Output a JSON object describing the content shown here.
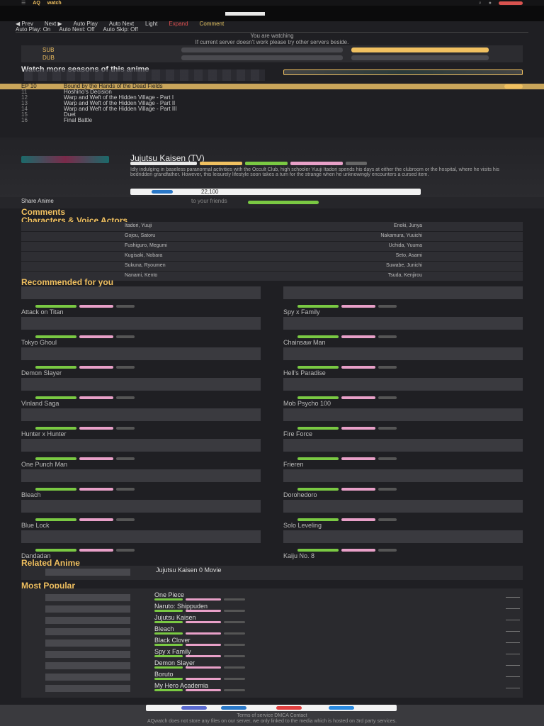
{
  "topbar": {
    "logo_top": "AQ",
    "logo_bottom": "watch"
  },
  "episode_nav": {
    "row1": [
      "◀ Prev",
      "Next ▶",
      "Auto Play",
      "Auto Next",
      "Light",
      "Expand",
      "Comment"
    ],
    "row2": [
      "Auto Play: On",
      "Auto Next: Off",
      "Auto Skip: Off"
    ]
  },
  "server_info": {
    "line1": "You are watching",
    "line2": "If current server doesn't work please try other servers beside."
  },
  "servers": {
    "sub_label": "SUB",
    "dub_label": "DUB"
  },
  "watch_title": "Watch more seasons of this anime",
  "episodes": [
    {
      "num": "EP 10",
      "title": "Bound by the Hands of the Dead Fields",
      "active": true
    },
    {
      "num": "11",
      "title": "Hoshino's Decision"
    },
    {
      "num": "12",
      "title": "Warp and Weft of the Hidden Village - Part I"
    },
    {
      "num": "13",
      "title": "Warp and Weft of the Hidden Village - Part II"
    },
    {
      "num": "14",
      "title": "Warp and Weft of the Hidden Village - Part III"
    },
    {
      "num": "15",
      "title": "Duet"
    },
    {
      "num": "16",
      "title": "Final Battle"
    }
  ],
  "anime": {
    "title": "Jujutsu Kaisen (TV)",
    "description": "Idly indulging in baseless paranormal activities with the Occult Club, high schooler Yuuji Itadori spends his days at either the clubroom or the hospital, where he visits his bedridden grandfather. However, this leisurely lifestyle soon takes a turn for the strange when he unknowingly encounters a cursed item.",
    "share_count": "22,100"
  },
  "share": {
    "label": "Share Anime",
    "sub": "to your friends"
  },
  "comments_title": "Comments",
  "characters_title": "Characters & Voice Actors",
  "characters": [
    {
      "name": "Itadori, Yuuji",
      "va": "Enoki, Junya"
    },
    {
      "name": "Gojou, Satoru",
      "va": "Nakamura, Yuuichi"
    },
    {
      "name": "Fushiguro, Megumi",
      "va": "Uchida, Yuuma"
    },
    {
      "name": "Kugisaki, Nobara",
      "va": "Seto, Asami"
    },
    {
      "name": "Sukuna, Ryoumen",
      "va": "Suwabe, Junichi"
    },
    {
      "name": "Nanami, Kento",
      "va": "Tsuda, Kenjirou"
    }
  ],
  "recommended_title": "Recommended for you",
  "recommended": [
    {
      "title": "Attack on Titan",
      "side": "left"
    },
    {
      "title": "Spy x Family",
      "side": "right"
    },
    {
      "title": "Tokyo Ghoul",
      "side": "left"
    },
    {
      "title": "Chainsaw Man",
      "side": "right"
    },
    {
      "title": "Demon Slayer",
      "side": "left"
    },
    {
      "title": "Hell's Paradise",
      "side": "right"
    },
    {
      "title": "Vinland Saga",
      "side": "left"
    },
    {
      "title": "Mob Psycho 100",
      "side": "right"
    },
    {
      "title": "Hunter x Hunter",
      "side": "left"
    },
    {
      "title": "Fire Force",
      "side": "right"
    },
    {
      "title": "One Punch Man",
      "side": "left"
    },
    {
      "title": "Frieren",
      "side": "right"
    },
    {
      "title": "Bleach",
      "side": "left"
    },
    {
      "title": "Dorohedoro",
      "side": "right"
    },
    {
      "title": "Blue Lock",
      "side": "left"
    },
    {
      "title": "Solo Leveling",
      "side": "right"
    },
    {
      "title": "Dandadan",
      "side": "left"
    },
    {
      "title": "Kaiju No. 8",
      "side": "right"
    }
  ],
  "related_title": "Related Anime",
  "related_item": "Jujutsu Kaisen 0 Movie",
  "popular_title": "Most Popular",
  "popular": [
    {
      "title": "One Piece"
    },
    {
      "title": "Naruto: Shippuden"
    },
    {
      "title": "Jujutsu Kaisen"
    },
    {
      "title": "Bleach"
    },
    {
      "title": "Black Clover"
    },
    {
      "title": "Spy x Family"
    },
    {
      "title": "Demon Slayer"
    },
    {
      "title": "Boruto"
    },
    {
      "title": "My Hero Academia"
    }
  ],
  "footer": {
    "line1": "Terms of service   DMCA   Contact",
    "line2": "AQwatch does not store any files on our server, we only linked to the media which is hosted on 3rd party services."
  },
  "colors": {
    "accent": "#f0c060",
    "green": "#7ac943",
    "pink": "#e8a0c8",
    "orange": "#e06020"
  }
}
